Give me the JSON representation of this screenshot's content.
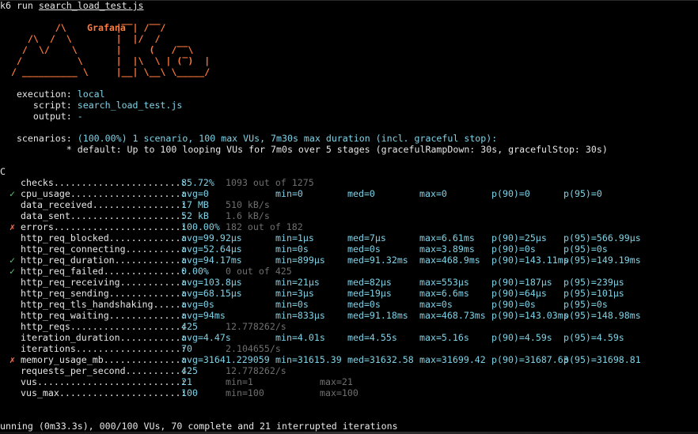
{
  "command": {
    "prompt": "k6",
    "verb": "run",
    "file": "search_load_test.js"
  },
  "logo": {
    "text": "Grafana",
    "ascii": "          /\\         |‾‾| /‾‾/\n     /\\  /  \\        |  |/  /\n    /  \\/    \\       |     (   /‾‾\\\n   /          \\      |  |\\  \\ | (‾)  |\n  / __________ \\     |__| \\__\\ \\_____/"
  },
  "info": [
    {
      "key": "   execution: ",
      "value": "local"
    },
    {
      "key": "      script: ",
      "value": "search_load_test.js"
    },
    {
      "key": "      output: ",
      "value": "-"
    }
  ],
  "scenarios": {
    "key": "   scenarios: ",
    "value": "(100.00%) 1 scenario, 100 max VUs, 7m30s max duration (incl. graceful stop):",
    "detail": "            * default: Up to 100 looping VUs for 7m0s over 5 stages (gracefulRampDown: 30s, gracefulStop: 30s)"
  },
  "interrupt_marker": "C",
  "metrics": [
    {
      "mark": "",
      "name": "checks.......................:",
      "v1": "85.72%",
      "v1dim": "1093 out of 1275"
    },
    {
      "mark": "✓",
      "name": "cpu_usage....................:",
      "avg": "avg=0",
      "min": "min=0",
      "med": "med=0",
      "max": "max=0",
      "p90": "p(90)=0",
      "p95": "p(95)=0"
    },
    {
      "mark": "",
      "name": "data_received................:",
      "v1": "17 MB",
      "v1dim": "510 kB/s"
    },
    {
      "mark": "",
      "name": "data_sent....................:",
      "v1": "52 kB",
      "v1dim": "1.6 kB/s"
    },
    {
      "mark": "✗",
      "name": "errors.......................:",
      "v1": "100.00%",
      "v1dim": "182 out of 182"
    },
    {
      "mark": "",
      "name": "http_req_blocked.............:",
      "avg": "avg=99.92µs",
      "min": "min=1µs",
      "med": "med=7µs",
      "max": "max=6.61ms",
      "p90": "p(90)=25µs",
      "p95": "p(95)=566.99µs"
    },
    {
      "mark": "",
      "name": "http_req_connecting..........:",
      "avg": "avg=52.64µs",
      "min": "min=0s",
      "med": "med=0s",
      "max": "max=3.89ms",
      "p90": "p(90)=0s",
      "p95": "p(95)=0s"
    },
    {
      "mark": "✓",
      "name": "http_req_duration............:",
      "avg": "avg=94.17ms",
      "min": "min=899µs",
      "med": "med=91.32ms",
      "max": "max=468.9ms",
      "p90": "p(90)=143.11ms",
      "p95": "p(95)=149.19ms"
    },
    {
      "mark": "✓",
      "name": "http_req_failed..............:",
      "v1": "0.00%",
      "v1dim": "0 out of 425"
    },
    {
      "mark": "",
      "name": "http_req_receiving...........:",
      "avg": "avg=103.8µs",
      "min": "min=21µs",
      "med": "med=82µs",
      "max": "max=553µs",
      "p90": "p(90)=187µs",
      "p95": "p(95)=239µs"
    },
    {
      "mark": "",
      "name": "http_req_sending.............:",
      "avg": "avg=68.15µs",
      "min": "min=3µs",
      "med": "med=19µs",
      "max": "max=6.6ms",
      "p90": "p(90)=64µs",
      "p95": "p(95)=101µs"
    },
    {
      "mark": "",
      "name": "http_req_tls_handshaking.....:",
      "avg": "avg=0s",
      "min": "min=0s",
      "med": "med=0s",
      "max": "max=0s",
      "p90": "p(90)=0s",
      "p95": "p(95)=0s"
    },
    {
      "mark": "",
      "name": "http_req_waiting.............:",
      "avg": "avg=94ms",
      "min": "min=833µs",
      "med": "med=91.18ms",
      "max": "max=468.73ms",
      "p90": "p(90)=143.03ms",
      "p95": "p(95)=148.98ms"
    },
    {
      "mark": "",
      "name": "http_reqs....................:",
      "v1": "425",
      "v1dim": "12.778262/s"
    },
    {
      "mark": "",
      "name": "iteration_duration...........:",
      "avg": "avg=4.47s",
      "min": "min=4.01s",
      "med": "med=4.55s",
      "max": "max=5.16s",
      "p90": "p(90)=4.59s",
      "p95": "p(95)=4.59s"
    },
    {
      "mark": "",
      "name": "iterations...................:",
      "v1": "70",
      "v1dim": "2.104655/s"
    },
    {
      "mark": "✗",
      "name": "memory_usage_mb..............:",
      "avg": "avg=31641.229059",
      "min": "min=31615.39",
      "med": "med=31632.58",
      "max": "max=31699.42",
      "p90": "p(90)=31687.63",
      "p95": "p(95)=31698.81"
    },
    {
      "mark": "",
      "name": "requests_per_second..........:",
      "v1": "425",
      "v1dim": "12.778262/s"
    },
    {
      "mark": "",
      "name": "vus..........................:",
      "v1": "21",
      "vmin": "min=1",
      "vmax": "max=21"
    },
    {
      "mark": "",
      "name": "vus_max......................:",
      "v1": "100",
      "vmin": "min=100",
      "vmax": "max=100"
    }
  ],
  "status_line": "unning (0m33.3s), 000/100 VUs, 70 complete and 21 interrupted iterations",
  "colors": {
    "accent": "#7fd3e8",
    "fail": "#ff7657",
    "logo": "#ff7a3d",
    "dim": "#6f6f6f",
    "pass": "#55d178"
  }
}
